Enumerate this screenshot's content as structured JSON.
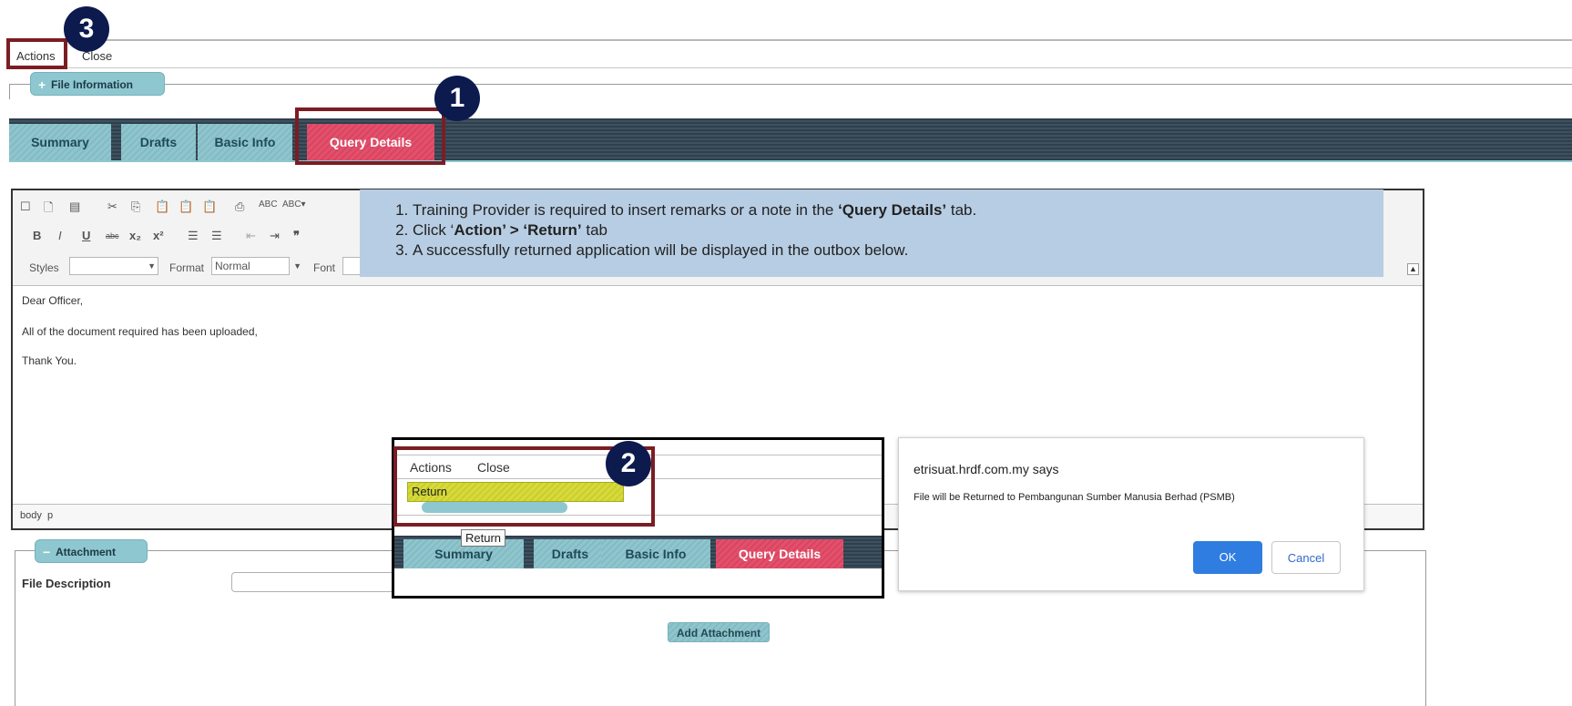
{
  "menubar": {
    "actions": "Actions",
    "close": "Close"
  },
  "file_info": {
    "label": "File Information",
    "toggle": "+"
  },
  "tabs": [
    "Summary",
    "Drafts",
    "Basic Info",
    "Query Details"
  ],
  "badges": {
    "one": "1",
    "two": "2",
    "three": "3"
  },
  "toolbar": {
    "styles_label": "Styles",
    "format_label": "Format",
    "format_value": "Normal",
    "font_label": "Font"
  },
  "editor": {
    "lines": [
      "Dear Officer,",
      "All of the document required has been uploaded,",
      "Thank You."
    ],
    "status_path": [
      "body",
      "p"
    ]
  },
  "callout": {
    "item1_a": "Training Provider is required to insert remarks or a note in the ",
    "item1_b": "‘Query Details’",
    "item1_c": " tab.",
    "item2_a": "Click ‘",
    "item2_b": "Action’ > ‘Return’",
    "item2_c": " tab",
    "item3": "A successfully returned application will be displayed in the outbox below."
  },
  "attachment": {
    "label": "Attachment",
    "toggle": "−",
    "file_description_label": "File Description",
    "add_button": "Add Attachment"
  },
  "inset": {
    "menu_actions": "Actions",
    "menu_close": "Close",
    "dropdown_item": "Return",
    "tooltip": "Return",
    "tabs": [
      "Summary",
      "Drafts",
      "Basic Info",
      "Query Details"
    ]
  },
  "dialog": {
    "title": "etrisuat.hrdf.com.my says",
    "message": "File will be Returned to Pembangunan Sumber Manusia Berhad (PSMB)",
    "ok": "OK",
    "cancel": "Cancel"
  },
  "colors": {
    "active_tab": "#e2506b",
    "tab": "#90c5cd",
    "highlight_border": "#7b1d24",
    "badge": "#0c1a4e",
    "callout": "#b7cde3",
    "ok_button": "#2f7de1"
  }
}
